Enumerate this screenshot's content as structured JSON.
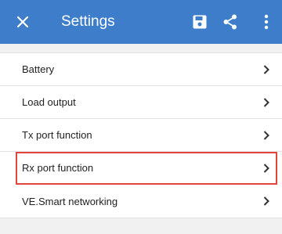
{
  "app_bar": {
    "title": "Settings",
    "background": "#3d7dca",
    "icons": [
      "close-icon",
      "save-icon",
      "share-icon",
      "more-vert-icon"
    ]
  },
  "settings": {
    "items": [
      {
        "label": "Battery"
      },
      {
        "label": "Load output"
      },
      {
        "label": "Tx port function"
      },
      {
        "label": "Rx port function",
        "highlighted": true
      },
      {
        "label": "VE.Smart networking"
      }
    ]
  },
  "highlight_color": "#e0473a"
}
